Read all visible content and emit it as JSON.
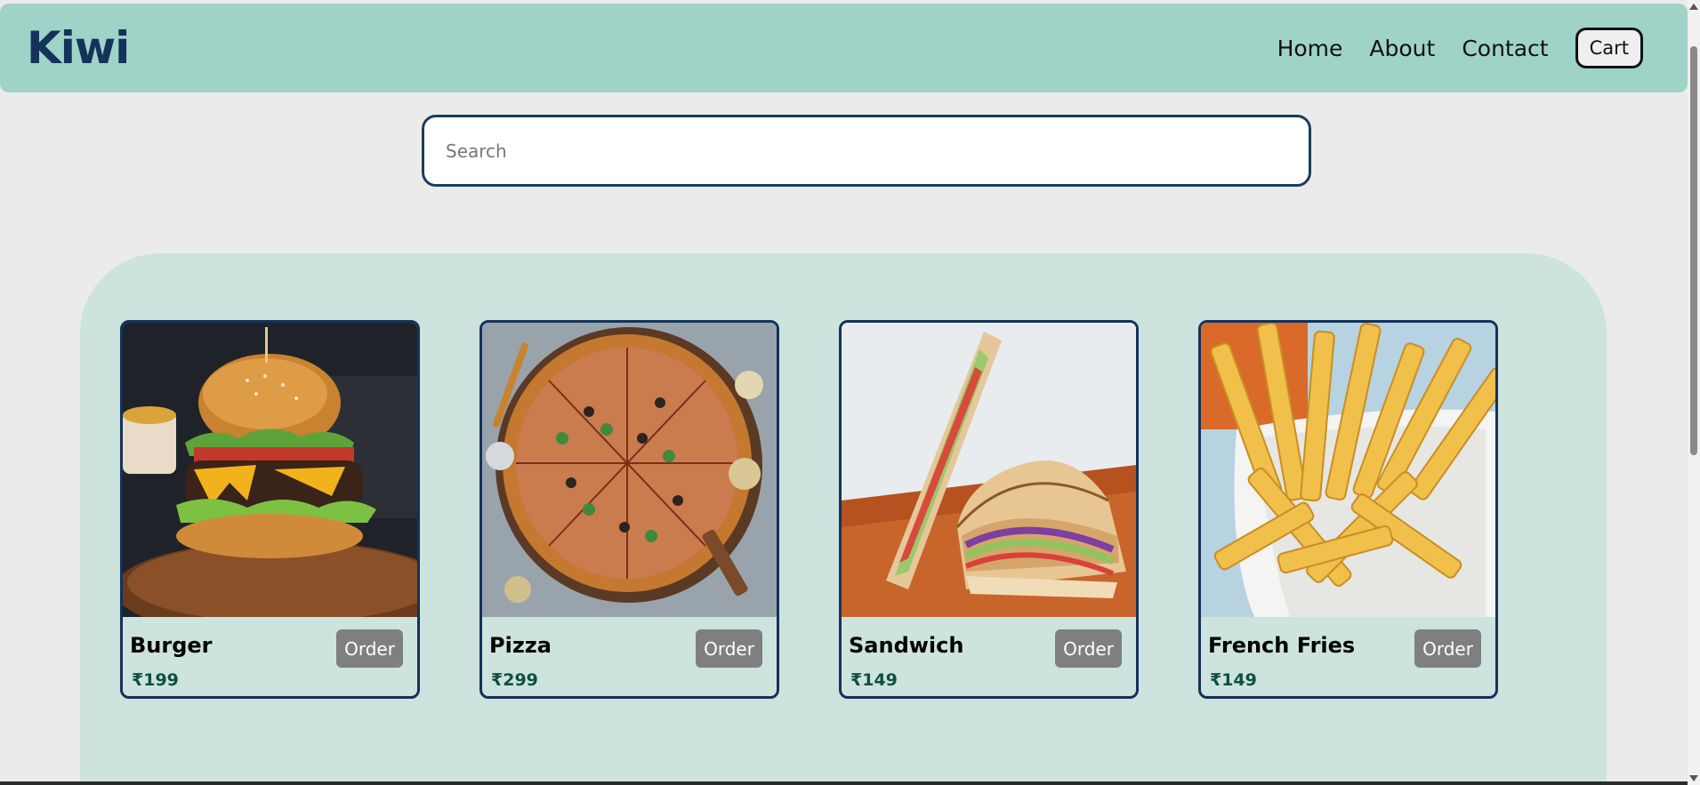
{
  "header": {
    "brand": "Kiwi",
    "nav": [
      "Home",
      "About",
      "Contact"
    ],
    "cart_label": "Cart"
  },
  "search": {
    "placeholder": "Search",
    "value": ""
  },
  "products": [
    {
      "name": "Burger",
      "price": "₹199",
      "order_label": "Order",
      "image": "burger"
    },
    {
      "name": "Pizza",
      "price": "₹299",
      "order_label": "Order",
      "image": "pizza"
    },
    {
      "name": "Sandwich",
      "price": "₹149",
      "order_label": "Order",
      "image": "sandwich"
    },
    {
      "name": "French Fries",
      "price": "₹149",
      "order_label": "Order",
      "image": "french-fries"
    }
  ],
  "colors": {
    "header_bg": "#9fd3c7",
    "brand": "#14325a",
    "panel_bg": "#cde3dd",
    "page_bg": "#ebebeb",
    "price": "#0d4f44",
    "order_button": "#7f7f7f"
  }
}
